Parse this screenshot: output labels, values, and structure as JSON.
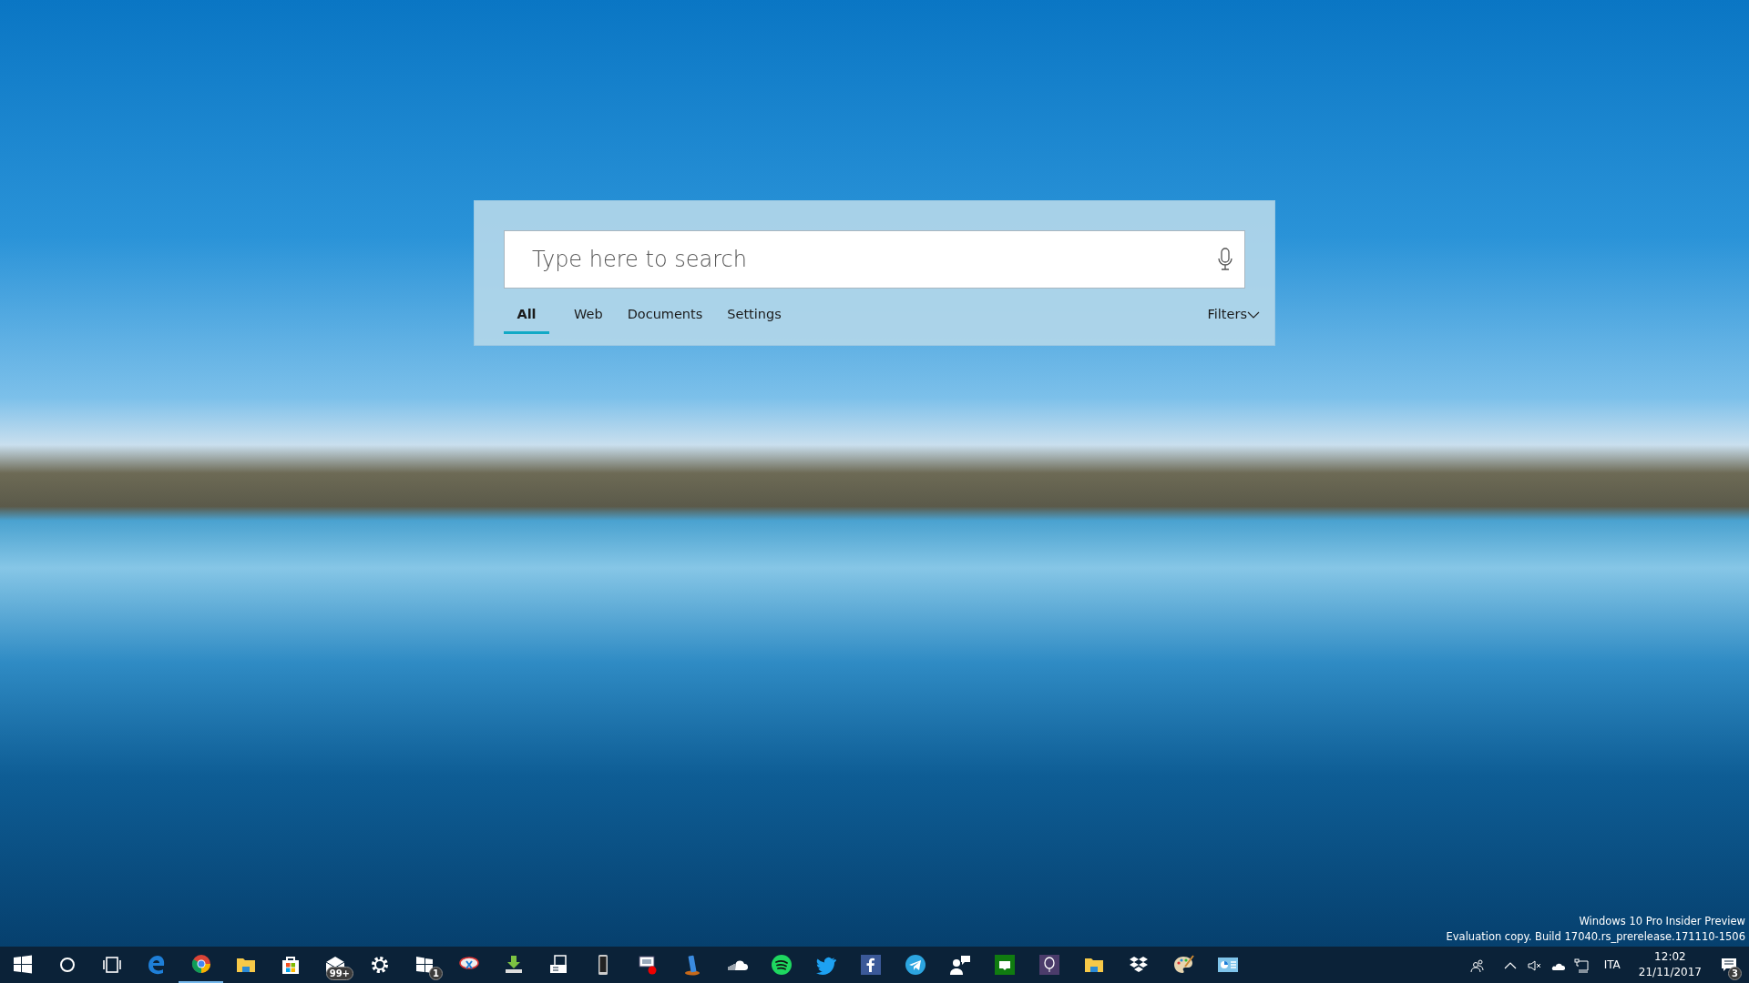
{
  "search": {
    "placeholder": "Type here to search",
    "tabs": [
      {
        "label": "All",
        "selected": true
      },
      {
        "label": "Web",
        "selected": false
      },
      {
        "label": "Documents",
        "selected": false
      },
      {
        "label": "Settings",
        "selected": false
      }
    ],
    "filters": "Filters"
  },
  "watermark": [
    "Windows 10 Pro Insider Preview",
    "Evaluation copy. Build 17040.rs_prerelease.171110-1506"
  ],
  "taskbar": {
    "apps": [
      {
        "kind": "start",
        "active": false
      },
      {
        "kind": "cortana",
        "active": false
      },
      {
        "kind": "taskview",
        "active": false
      },
      {
        "kind": "edge",
        "active": false
      },
      {
        "kind": "chrome",
        "active": true
      },
      {
        "kind": "folder",
        "active": false
      },
      {
        "kind": "store",
        "active": false
      },
      {
        "kind": "mail",
        "active": false,
        "badge": "99+"
      },
      {
        "kind": "gear",
        "active": false
      },
      {
        "kind": "tiles",
        "active": false,
        "badge": "1"
      },
      {
        "kind": "snip",
        "active": false
      },
      {
        "kind": "download",
        "active": false
      },
      {
        "kind": "printer",
        "active": false
      },
      {
        "kind": "phone",
        "active": false
      },
      {
        "kind": "monitor",
        "active": false
      },
      {
        "kind": "phone2",
        "active": false
      },
      {
        "kind": "cloud",
        "active": false
      },
      {
        "kind": "spotify",
        "active": false
      },
      {
        "kind": "bird",
        "active": false
      },
      {
        "kind": "fbox",
        "active": false
      },
      {
        "kind": "plane",
        "active": false
      },
      {
        "kind": "people",
        "active": false
      },
      {
        "kind": "game",
        "active": false
      },
      {
        "kind": "balloon",
        "active": false
      },
      {
        "kind": "folder",
        "active": false
      },
      {
        "kind": "dropbox",
        "active": false
      },
      {
        "kind": "palette",
        "active": false
      },
      {
        "kind": "chartwin",
        "active": false
      }
    ],
    "tray": {
      "language": "ITA",
      "time": "12:02",
      "date": "21/11/2017",
      "notifications": "3"
    }
  }
}
